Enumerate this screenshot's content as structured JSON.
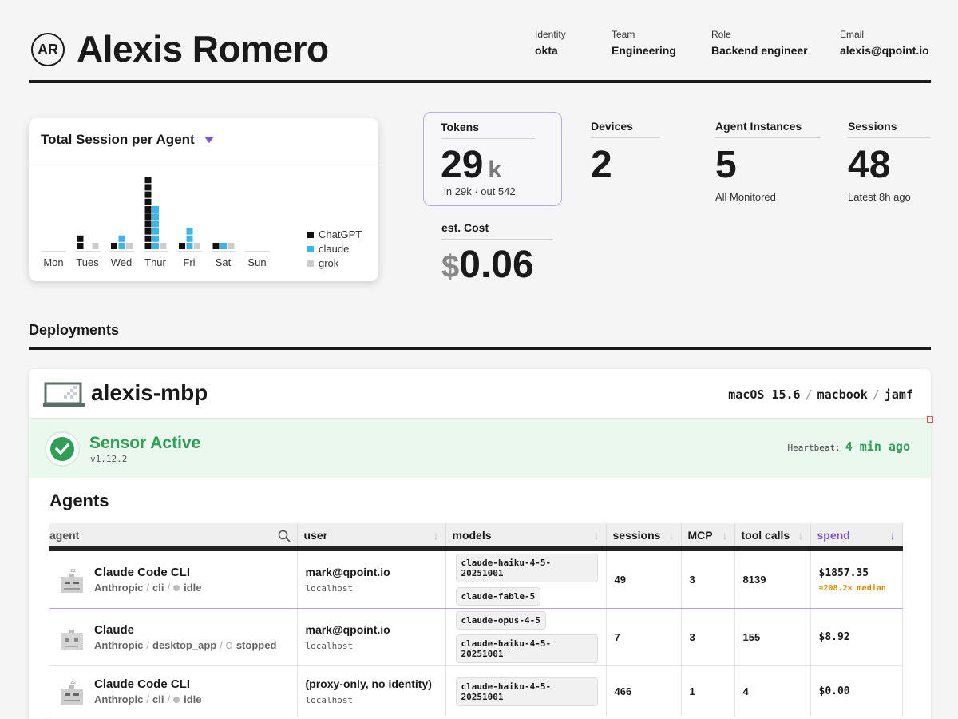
{
  "profile": {
    "initials": "AR",
    "name": "Alexis Romero",
    "meta": [
      {
        "label": "Identity",
        "value": "okta"
      },
      {
        "label": "Team",
        "value": "Engineering"
      },
      {
        "label": "Role",
        "value": "Backend engineer"
      },
      {
        "label": "Email",
        "value": "alexis@qpoint.io"
      }
    ]
  },
  "chart_data": {
    "type": "bar",
    "title": "Total Session per Agent",
    "categories": [
      "Mon",
      "Tues",
      "Wed",
      "Thur",
      "Fri",
      "Sat",
      "Sun"
    ],
    "series": [
      {
        "name": "ChatGPT",
        "values": [
          0,
          2,
          1,
          10,
          1,
          1,
          0
        ]
      },
      {
        "name": "claude",
        "values": [
          0,
          0,
          2,
          6,
          3,
          1,
          0
        ]
      },
      {
        "name": "grok",
        "values": [
          0,
          1,
          1,
          1,
          1,
          1,
          0
        ]
      }
    ],
    "legend_position": "right",
    "colors": {
      "ChatGPT": "#111111",
      "claude": "#3bb5ea",
      "grok": "#cccccc"
    }
  },
  "stats": {
    "tokens": {
      "label": "Tokens",
      "value": "29",
      "unit": "k",
      "sub": "in 29k · out 542"
    },
    "cost": {
      "label": "est. Cost",
      "currency": "$",
      "value": "0.06"
    },
    "devices": {
      "label": "Devices",
      "value": "2"
    },
    "instances": {
      "label": "Agent Instances",
      "value": "5",
      "sub": "All Monitored"
    },
    "sessions": {
      "label": "Sessions",
      "value": "48",
      "sub": "Latest 8h ago"
    }
  },
  "deployments": {
    "title": "Deployments",
    "host": {
      "name": "alexis-mbp",
      "os": "macOS 15.6",
      "model": "macbook",
      "mdm": "jamf",
      "sep": "/"
    },
    "sensor": {
      "status": "Sensor Active",
      "version": "v1.12.2",
      "heartbeat_label": "Heartbeat:",
      "heartbeat_value": "4 min ago"
    },
    "agents_title": "Agents",
    "columns": [
      "agent",
      "user",
      "models",
      "sessions",
      "MCP",
      "tool calls",
      "spend"
    ],
    "rows": [
      {
        "name": "Claude Code CLI",
        "vendor": "Anthropic",
        "type": "cli",
        "state": "idle",
        "user": "mark@qpoint.io",
        "host": "localhost",
        "models": [
          "claude-haiku-4-5-20251001",
          "claude-fable-5"
        ],
        "sessions": "49",
        "mcp": "3",
        "tool_calls": "8139",
        "spend": "$1857.35",
        "spend_note": "≈208.2× median"
      },
      {
        "name": "Claude",
        "vendor": "Anthropic",
        "type": "desktop_app",
        "state": "stopped",
        "user": "mark@qpoint.io",
        "host": "localhost",
        "models": [
          "claude-opus-4-5",
          "claude-haiku-4-5-20251001"
        ],
        "sessions": "7",
        "mcp": "3",
        "tool_calls": "155",
        "spend": "$8.92"
      },
      {
        "name": "Claude Code CLI",
        "vendor": "Anthropic",
        "type": "cli",
        "state": "idle",
        "user": "(proxy-only, no identity)",
        "host": "localhost",
        "models": [
          "claude-haiku-4-5-20251001"
        ],
        "sessions": "466",
        "mcp": "1",
        "tool_calls": "4",
        "spend": "$0.00"
      }
    ]
  }
}
